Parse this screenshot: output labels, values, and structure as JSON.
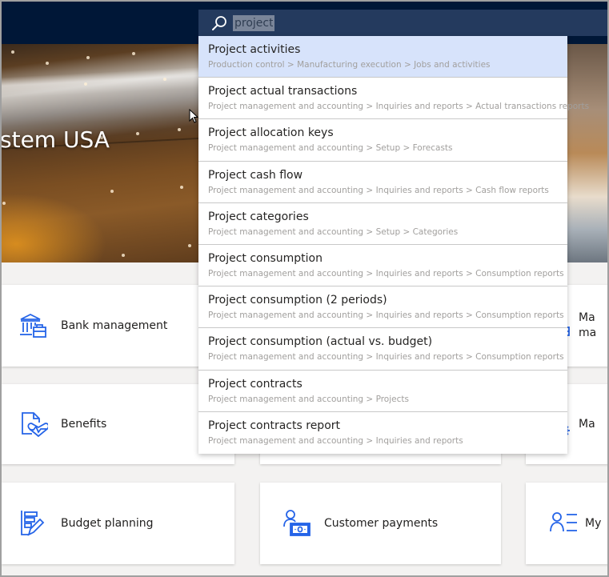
{
  "header": {
    "search": {
      "value": "project",
      "icon": "search-icon"
    }
  },
  "hero": {
    "title": "stem USA"
  },
  "search_results": [
    {
      "title": "Project activities",
      "path": "Production control > Manufacturing execution > Jobs and activities",
      "selected": true
    },
    {
      "title": "Project actual transactions",
      "path": "Project management and accounting > Inquiries and reports > Actual transactions reports",
      "selected": false
    },
    {
      "title": "Project allocation keys",
      "path": "Project management and accounting > Setup > Forecasts",
      "selected": false
    },
    {
      "title": "Project cash flow",
      "path": "Project management and accounting > Inquiries and reports > Cash flow reports",
      "selected": false
    },
    {
      "title": "Project categories",
      "path": "Project management and accounting > Setup > Categories",
      "selected": false
    },
    {
      "title": "Project consumption",
      "path": "Project management and accounting > Inquiries and reports > Consumption reports",
      "selected": false
    },
    {
      "title": "Project consumption (2 periods)",
      "path": "Project management and accounting > Inquiries and reports > Consumption reports",
      "selected": false
    },
    {
      "title": "Project consumption (actual vs. budget)",
      "path": "Project management and accounting > Inquiries and reports > Consumption reports",
      "selected": false
    },
    {
      "title": "Project contracts",
      "path": "Project management and accounting > Projects",
      "selected": false
    },
    {
      "title": "Project contracts report",
      "path": "Project management and accounting > Inquiries and reports",
      "selected": false
    }
  ],
  "tiles": [
    {
      "label": "Bank management",
      "icon": "bank-briefcase-icon"
    },
    {
      "label": "Ma ma",
      "label_line1": "Ma",
      "label_line2": "ma",
      "icon": "document-grid-icon"
    },
    {
      "label": "Benefits",
      "icon": "document-heart-icon"
    },
    {
      "label": "Ma",
      "icon": "gear-document-icon"
    },
    {
      "label": "Budget planning",
      "icon": "list-pencil-icon"
    },
    {
      "label": "Customer payments",
      "icon": "person-money-icon"
    },
    {
      "label": "My",
      "icon": "person-list-icon"
    }
  ],
  "colors": {
    "topbar": "#001737",
    "search_bar": "#243a5e",
    "selected_result": "#d7e3fb",
    "icon_blue": "#2564e8",
    "page_bg": "#f3f2f1"
  }
}
